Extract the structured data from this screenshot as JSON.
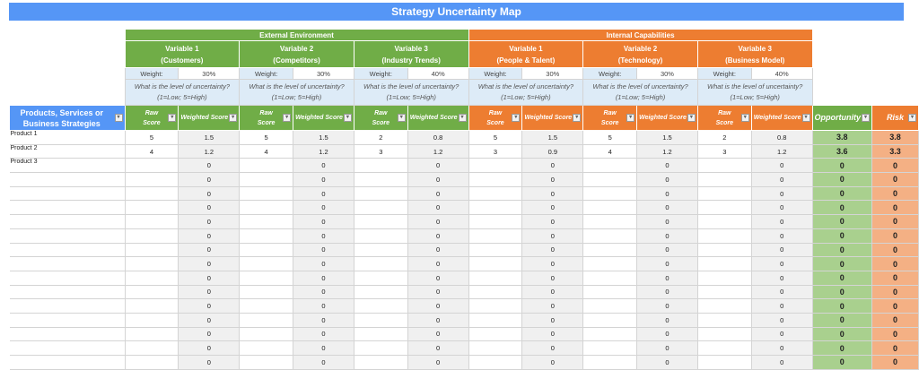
{
  "title": "Strategy Uncertainty Map",
  "groups": [
    {
      "label": "External Environment",
      "color": "#70ad47"
    },
    {
      "label": "Internal Capabilities",
      "color": "#ed7d31"
    }
  ],
  "variables": [
    {
      "name": "Variable 1",
      "sub": "(Customers)",
      "weight": "30%",
      "group": 0
    },
    {
      "name": "Variable 2",
      "sub": "(Competitors)",
      "weight": "30%",
      "group": 0
    },
    {
      "name": "Variable 3",
      "sub": "(Industry Trends)",
      "weight": "40%",
      "group": 0
    },
    {
      "name": "Variable 1",
      "sub": "(People & Talent)",
      "weight": "30%",
      "group": 1
    },
    {
      "name": "Variable 2",
      "sub": "(Technology)",
      "weight": "30%",
      "group": 1
    },
    {
      "name": "Variable 3",
      "sub": "(Business Model)",
      "weight": "40%",
      "group": 1
    }
  ],
  "weight_label": "Weight:",
  "question": "What is the level of uncertainty?",
  "scale": "(1=Low; 5=High)",
  "columns": {
    "label": "Products, Services or Business Strategies",
    "raw": "Raw Score",
    "weighted": "Weighted Score",
    "opportunity": "Opportunity",
    "risk": "Risk",
    "dropdown_icon": "filter-dropdown-icon"
  },
  "rows": [
    {
      "label": "Product 1",
      "scores": [
        [
          "5",
          "1.5"
        ],
        [
          "5",
          "1.5"
        ],
        [
          "2",
          "0.8"
        ],
        [
          "5",
          "1.5"
        ],
        [
          "5",
          "1.5"
        ],
        [
          "2",
          "0.8"
        ]
      ],
      "opportunity": "3.8",
      "risk": "3.8"
    },
    {
      "label": "Product 2",
      "scores": [
        [
          "4",
          "1.2"
        ],
        [
          "4",
          "1.2"
        ],
        [
          "3",
          "1.2"
        ],
        [
          "3",
          "0.9"
        ],
        [
          "4",
          "1.2"
        ],
        [
          "3",
          "1.2"
        ]
      ],
      "opportunity": "3.6",
      "risk": "3.3"
    },
    {
      "label": "Product 3",
      "scores": [
        [
          "",
          "0"
        ],
        [
          "",
          "0"
        ],
        [
          "",
          "0"
        ],
        [
          "",
          "0"
        ],
        [
          "",
          "0"
        ],
        [
          "",
          "0"
        ]
      ],
      "opportunity": "0",
      "risk": "0"
    },
    {
      "label": "",
      "scores": [
        [
          "",
          "0"
        ],
        [
          "",
          "0"
        ],
        [
          "",
          "0"
        ],
        [
          "",
          "0"
        ],
        [
          "",
          "0"
        ],
        [
          "",
          "0"
        ]
      ],
      "opportunity": "0",
      "risk": "0"
    },
    {
      "label": "",
      "scores": [
        [
          "",
          "0"
        ],
        [
          "",
          "0"
        ],
        [
          "",
          "0"
        ],
        [
          "",
          "0"
        ],
        [
          "",
          "0"
        ],
        [
          "",
          "0"
        ]
      ],
      "opportunity": "0",
      "risk": "0"
    },
    {
      "label": "",
      "scores": [
        [
          "",
          "0"
        ],
        [
          "",
          "0"
        ],
        [
          "",
          "0"
        ],
        [
          "",
          "0"
        ],
        [
          "",
          "0"
        ],
        [
          "",
          "0"
        ]
      ],
      "opportunity": "0",
      "risk": "0"
    },
    {
      "label": "",
      "scores": [
        [
          "",
          "0"
        ],
        [
          "",
          "0"
        ],
        [
          "",
          "0"
        ],
        [
          "",
          "0"
        ],
        [
          "",
          "0"
        ],
        [
          "",
          "0"
        ]
      ],
      "opportunity": "0",
      "risk": "0"
    },
    {
      "label": "",
      "scores": [
        [
          "",
          "0"
        ],
        [
          "",
          "0"
        ],
        [
          "",
          "0"
        ],
        [
          "",
          "0"
        ],
        [
          "",
          "0"
        ],
        [
          "",
          "0"
        ]
      ],
      "opportunity": "0",
      "risk": "0"
    },
    {
      "label": "",
      "scores": [
        [
          "",
          "0"
        ],
        [
          "",
          "0"
        ],
        [
          "",
          "0"
        ],
        [
          "",
          "0"
        ],
        [
          "",
          "0"
        ],
        [
          "",
          "0"
        ]
      ],
      "opportunity": "0",
      "risk": "0"
    },
    {
      "label": "",
      "scores": [
        [
          "",
          "0"
        ],
        [
          "",
          "0"
        ],
        [
          "",
          "0"
        ],
        [
          "",
          "0"
        ],
        [
          "",
          "0"
        ],
        [
          "",
          "0"
        ]
      ],
      "opportunity": "0",
      "risk": "0"
    },
    {
      "label": "",
      "scores": [
        [
          "",
          "0"
        ],
        [
          "",
          "0"
        ],
        [
          "",
          "0"
        ],
        [
          "",
          "0"
        ],
        [
          "",
          "0"
        ],
        [
          "",
          "0"
        ]
      ],
      "opportunity": "0",
      "risk": "0"
    },
    {
      "label": "",
      "scores": [
        [
          "",
          "0"
        ],
        [
          "",
          "0"
        ],
        [
          "",
          "0"
        ],
        [
          "",
          "0"
        ],
        [
          "",
          "0"
        ],
        [
          "",
          "0"
        ]
      ],
      "opportunity": "0",
      "risk": "0"
    },
    {
      "label": "",
      "scores": [
        [
          "",
          "0"
        ],
        [
          "",
          "0"
        ],
        [
          "",
          "0"
        ],
        [
          "",
          "0"
        ],
        [
          "",
          "0"
        ],
        [
          "",
          "0"
        ]
      ],
      "opportunity": "0",
      "risk": "0"
    },
    {
      "label": "",
      "scores": [
        [
          "",
          "0"
        ],
        [
          "",
          "0"
        ],
        [
          "",
          "0"
        ],
        [
          "",
          "0"
        ],
        [
          "",
          "0"
        ],
        [
          "",
          "0"
        ]
      ],
      "opportunity": "0",
      "risk": "0"
    },
    {
      "label": "",
      "scores": [
        [
          "",
          "0"
        ],
        [
          "",
          "0"
        ],
        [
          "",
          "0"
        ],
        [
          "",
          "0"
        ],
        [
          "",
          "0"
        ],
        [
          "",
          "0"
        ]
      ],
      "opportunity": "0",
      "risk": "0"
    },
    {
      "label": "",
      "scores": [
        [
          "",
          "0"
        ],
        [
          "",
          "0"
        ],
        [
          "",
          "0"
        ],
        [
          "",
          "0"
        ],
        [
          "",
          "0"
        ],
        [
          "",
          "0"
        ]
      ],
      "opportunity": "0",
      "risk": "0"
    },
    {
      "label": "",
      "scores": [
        [
          "",
          "0"
        ],
        [
          "",
          "0"
        ],
        [
          "",
          "0"
        ],
        [
          "",
          "0"
        ],
        [
          "",
          "0"
        ],
        [
          "",
          "0"
        ]
      ],
      "opportunity": "0",
      "risk": "0"
    }
  ]
}
